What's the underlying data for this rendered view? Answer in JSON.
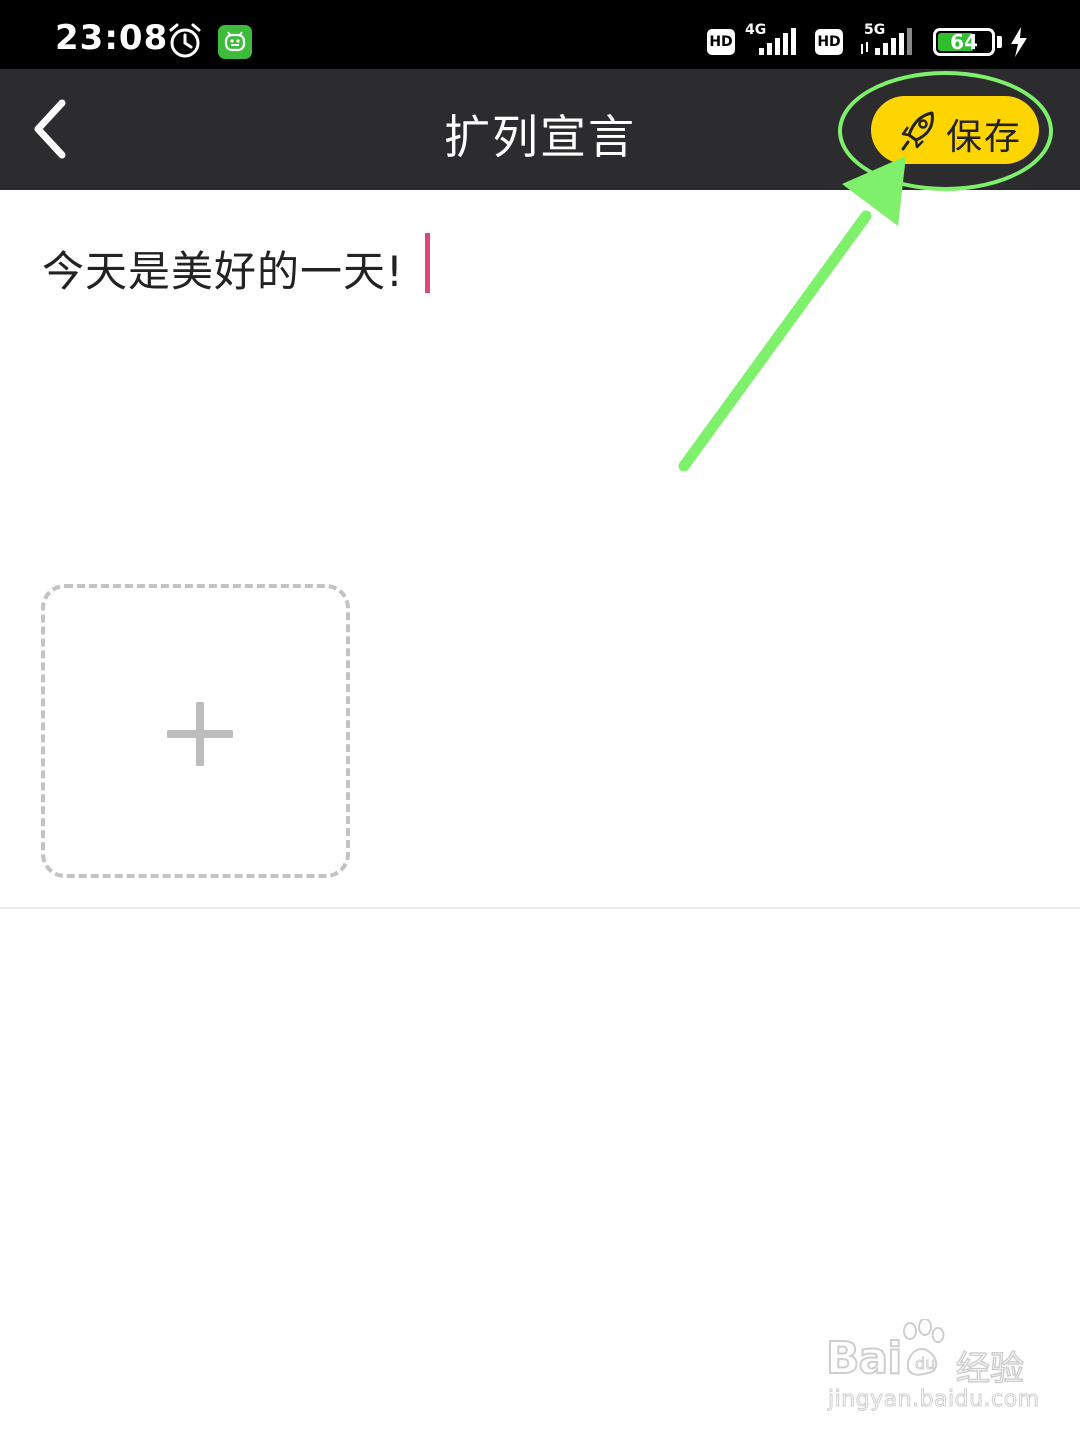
{
  "status_bar": {
    "time": "23:08",
    "hd_1": "HD",
    "network_1": "4G",
    "hd_2": "HD",
    "network_2": "5G",
    "battery": "64",
    "battery_level_percent": 64
  },
  "header": {
    "title": "扩列宣言",
    "save_label": "保存"
  },
  "editor": {
    "text": "今天是美好的一天!"
  },
  "watermark": {
    "logo": "Bai",
    "logo_suffix": "经验",
    "url": "jingyan.baidu.com"
  },
  "colors": {
    "header_bg": "#2c2c2e",
    "save_button": "#ffd500",
    "cursor": "#e0457b",
    "annotation": "#7ef06b"
  },
  "icons": [
    "alarm-icon",
    "app-notification-icon",
    "signal-icon",
    "battery-icon",
    "charging-icon",
    "back-arrow-icon",
    "rocket-icon",
    "plus-icon"
  ]
}
